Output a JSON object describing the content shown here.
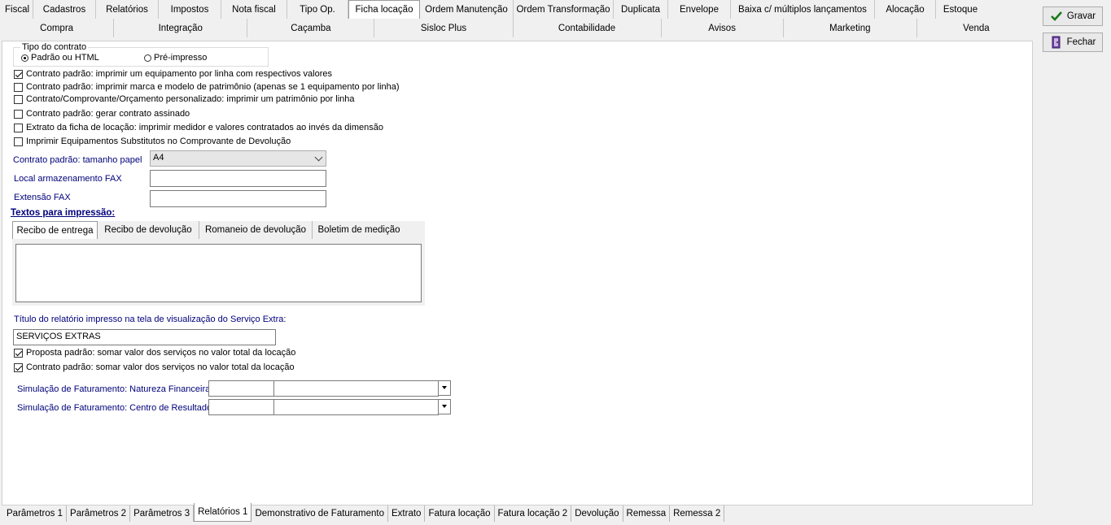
{
  "top_tabs_row1": [
    "Fiscal",
    "Cadastros",
    "Relatórios",
    "Impostos",
    "Nota fiscal",
    "Tipo Op.",
    "Ficha locação",
    "Ordem Manutenção",
    "Ordem Transformação",
    "Duplicata",
    "Envelope",
    "Baixa c/ múltiplos lançamentos",
    "Alocação",
    "Estoque"
  ],
  "top_tabs_row2": [
    "Compra",
    "Integração",
    "Caçamba",
    "Sisloc Plus",
    "Contabilidade",
    "Avisos",
    "Marketing",
    "Venda"
  ],
  "active_top_tab": "Ficha locação",
  "buttons": {
    "save": "Gravar",
    "close": "Fechar"
  },
  "contract_type": {
    "title": "Tipo do contrato",
    "option1": "Padrão ou HTML",
    "option2": "Pré-impresso"
  },
  "checkboxes": [
    {
      "label": "Contrato padrão: imprimir um equipamento por linha com respectivos valores",
      "checked": true
    },
    {
      "label": "Contrato padrão: imprimir marca e modelo de patrimônio (apenas se 1 equipamento por linha)",
      "checked": false
    },
    {
      "label": "Contrato/Comprovante/Orçamento personalizado: imprimir um patrimônio por linha",
      "checked": false
    },
    {
      "label": "Contrato padrão: gerar contrato assinado",
      "checked": false
    },
    {
      "label": "Extrato da ficha de locação: imprimir medidor e valores contratados ao invés da dimensão",
      "checked": false
    },
    {
      "label": "Imprimir Equipamentos Substitutos no Comprovante de Devolução",
      "checked": false
    }
  ],
  "fields": {
    "paper_size_label": "Contrato padrão: tamanho papel",
    "paper_size_value": "A4",
    "fax_storage_label": "Local armazenamento FAX",
    "fax_storage_value": "",
    "fax_ext_label": "Extensão FAX",
    "fax_ext_value": ""
  },
  "print_texts": {
    "title": "Textos para impressão:",
    "tabs": [
      "Recibo de entrega",
      "Recibo de devolução",
      "Romaneio de devolução",
      "Boletim de medição"
    ],
    "active_tab": "Recibo de entrega"
  },
  "extra_service": {
    "title_label": "Título do relatório impresso na tela de visualização do Serviço Extra:",
    "title_value": "SERVIÇOS EXTRAS",
    "check1": "Proposta padrão: somar valor dos serviços no valor total da locação",
    "check2": "Contrato padrão: somar valor dos serviços no valor total da locação"
  },
  "simulation": {
    "nature_label": "Simulação de Faturamento: Natureza Financeira",
    "center_label": "Simulação de Faturamento: Centro de Resultado"
  },
  "bottom_tabs": [
    "Parâmetros 1",
    "Parâmetros 2",
    "Parâmetros 3",
    "Relatórios 1",
    "Demonstrativo de Faturamento",
    "Extrato",
    "Fatura locação",
    "Fatura locação 2",
    "Devolução",
    "Remessa",
    "Remessa 2"
  ],
  "active_bottom_tab": "Relatórios 1"
}
